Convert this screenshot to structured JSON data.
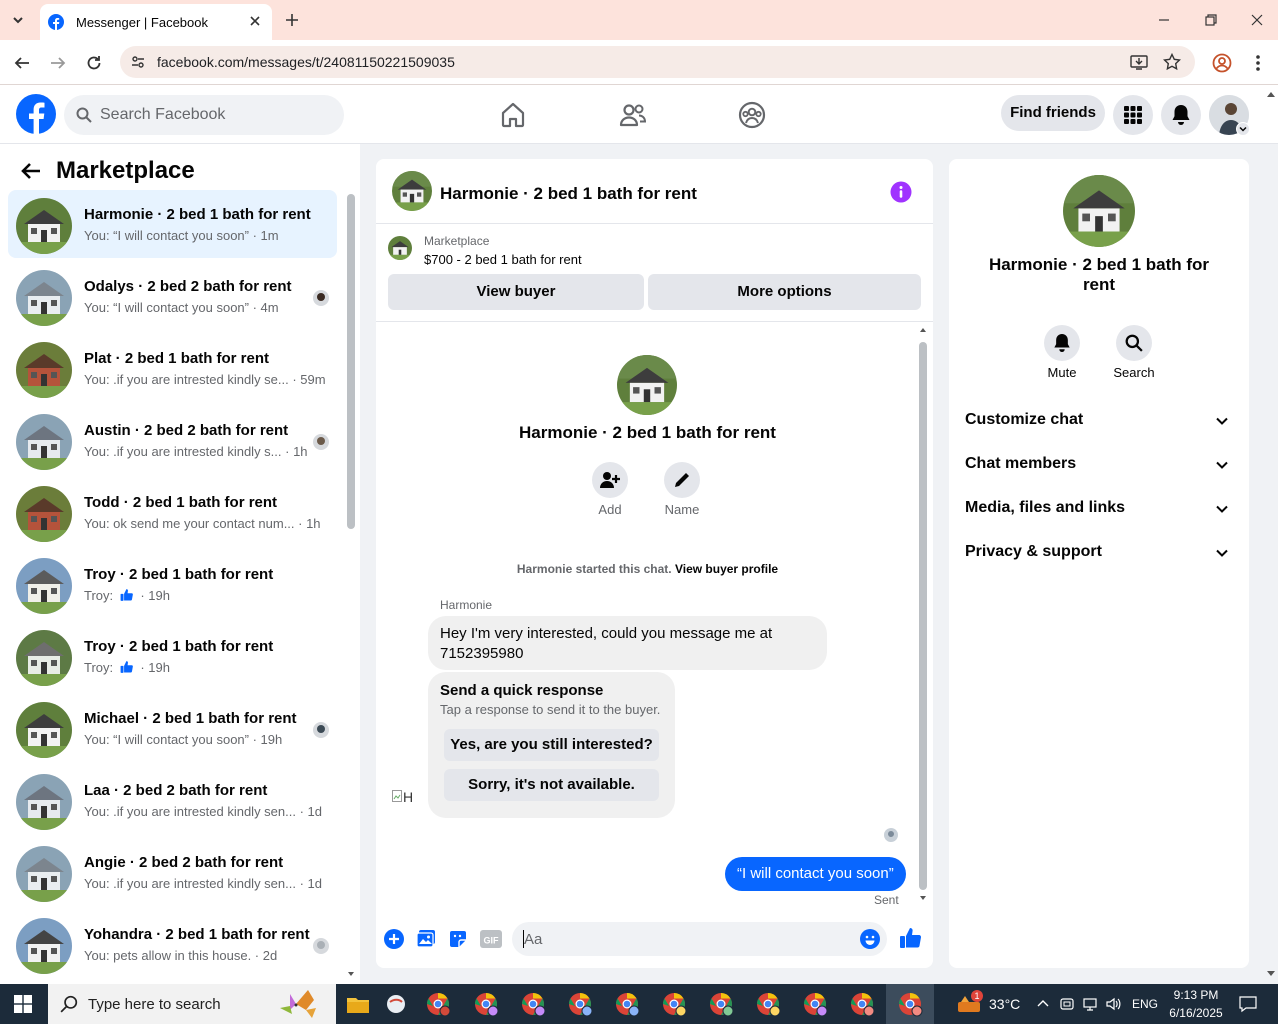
{
  "browser": {
    "tab_title": "Messenger | Facebook",
    "url": "facebook.com/messages/t/24081150221509035"
  },
  "fb": {
    "search_placeholder": "Search Facebook",
    "find_friends": "Find friends"
  },
  "sidebar": {
    "title": "Marketplace",
    "conversations": [
      {
        "name": "Harmonie · 2 bed 1 bath for rent",
        "preview": "You: “I will contact you soon” · 1m",
        "active": true
      },
      {
        "name": "Odalys · 2 bed 2 bath for rent",
        "preview": "You: “I will contact you soon” · 4m"
      },
      {
        "name": "Plat · 2 bed 1 bath for rent",
        "preview": "You: .if you are intrested kindly se... · 59m"
      },
      {
        "name": "Austin · 2 bed 2 bath for rent",
        "preview": "You: .if you are intrested kindly s... · 1h"
      },
      {
        "name": "Todd · 2 bed 1 bath for rent",
        "preview": "You: ok send me your contact num... · 1h"
      },
      {
        "name": "Troy · 2 bed 1 bath for rent",
        "preview": "Troy:  · 19h"
      },
      {
        "name": "Troy · 2 bed 1 bath for rent",
        "preview": "Troy:  · 19h"
      },
      {
        "name": "Michael · 2 bed 1 bath for rent",
        "preview": "You: “I will contact you soon” · 19h"
      },
      {
        "name": "Laa · 2 bed 2 bath for rent",
        "preview": "You: .if you are intrested kindly sen... · 1d"
      },
      {
        "name": "Angie · 2 bed 2 bath for rent",
        "preview": "You: .if you are intrested kindly sen... · 1d"
      },
      {
        "name": "Yohandra · 2 bed 1 bath for rent",
        "preview": "You: pets allow in this house. · 2d"
      }
    ]
  },
  "chat": {
    "title": "Harmonie · 2 bed 1 bath for rent",
    "listing_source": "Marketplace",
    "listing_title": "$700 - 2 bed 1 bath for rent",
    "view_buyer": "View buyer",
    "more_options": "More options",
    "intro_name": "Harmonie · 2 bed 1 bath for rent",
    "add_label": "Add",
    "name_label": "Name",
    "started_text": "Harmonie started this chat.",
    "view_buyer_profile": "View buyer profile",
    "sender_name": "Harmonie",
    "message_line1": "Hey I'm very interested, could you message me at",
    "message_line2": "7152395980",
    "quick_title": "Send a quick response",
    "quick_sub": "Tap a response to send it to the buyer.",
    "quick_1": "Yes, are you still interested?",
    "quick_2": "Sorry, it's not available.",
    "broken_avatar_alt": "H",
    "my_message": "“I will contact you soon”",
    "sent_status": "Sent",
    "composer_placeholder": "Aa"
  },
  "details": {
    "name": "Harmonie · 2 bed 1 bath for rent",
    "mute": "Mute",
    "search": "Search",
    "sections": [
      "Customize chat",
      "Chat members",
      "Media, files and links",
      "Privacy & support"
    ]
  },
  "taskbar": {
    "search_placeholder": "Type here to search",
    "temperature": "33°C",
    "weather_badge": "1",
    "language": "ENG",
    "time": "9:13 PM",
    "date": "6/16/2025"
  },
  "colors": {
    "fb_blue": "#0866ff",
    "messenger_purple": "#a033ff",
    "active_bg": "#e7f3ff",
    "browser_tab_bar": "#fde3dc"
  }
}
